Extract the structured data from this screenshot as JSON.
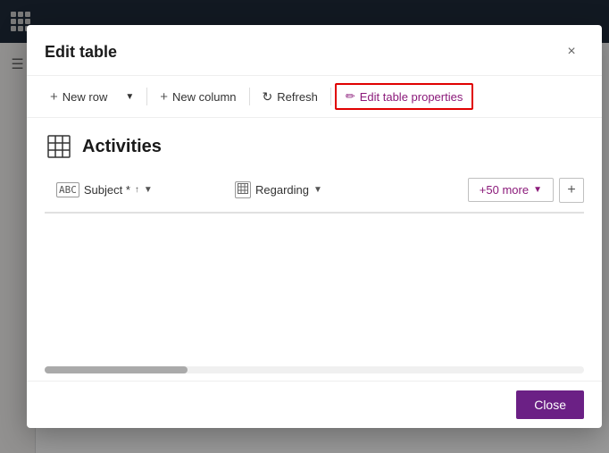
{
  "app": {
    "title": "Edit table"
  },
  "modal": {
    "title": "Edit table",
    "close_label": "×"
  },
  "toolbar": {
    "new_row_label": "New row",
    "new_column_label": "New column",
    "refresh_label": "Refresh",
    "edit_table_properties_label": "Edit table properties"
  },
  "table": {
    "name": "Activities",
    "icon": "table-icon"
  },
  "columns": {
    "subject_label": "Subject *",
    "regarding_label": "Regarding",
    "more_label": "+50 more",
    "add_label": "+"
  },
  "footer": {
    "close_label": "Close"
  },
  "scrollbar": {
    "thumb_width": 160
  }
}
